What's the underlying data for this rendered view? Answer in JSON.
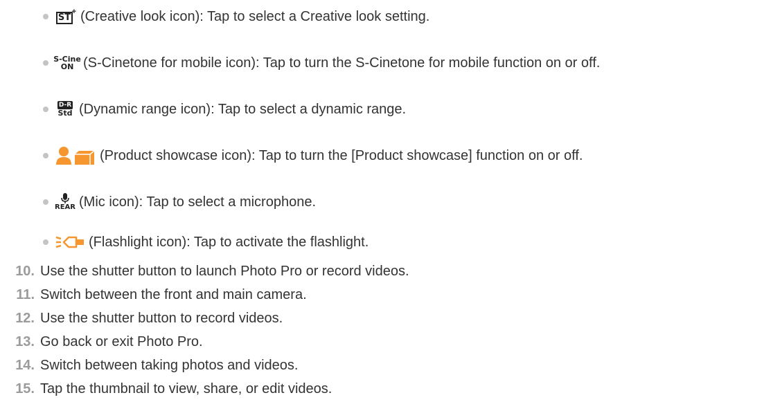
{
  "bullets": [
    {
      "icon": "creative-look-icon",
      "text": "(Creative look icon): Tap to select a Creative look setting."
    },
    {
      "icon": "s-cinetone-icon",
      "text": "(S-Cinetone for mobile icon): Tap to turn the S-Cinetone for mobile function on or off."
    },
    {
      "icon": "dynamic-range-icon",
      "text": "(Dynamic range icon): Tap to select a dynamic range."
    },
    {
      "icon": "product-showcase-icon",
      "text": "(Product showcase icon): Tap to turn the [Product showcase] function on or off."
    },
    {
      "icon": "mic-icon",
      "text": "(Mic icon): Tap to select a microphone."
    },
    {
      "icon": "flashlight-icon",
      "text": "(Flashlight icon): Tap to activate the flashlight."
    }
  ],
  "icon_text": {
    "st": "ST",
    "scine_top": "S-Cine",
    "scine_bottom": "ON",
    "dr_top": "D-R",
    "dr_bottom": "Std",
    "mic_bottom": "REAR"
  },
  "steps": [
    {
      "num": "10.",
      "text": "Use the shutter button to launch Photo Pro or record videos."
    },
    {
      "num": "11.",
      "text": "Switch between the front and main camera."
    },
    {
      "num": "12.",
      "text": "Use the shutter button to record videos."
    },
    {
      "num": "13.",
      "text": "Go back or exit Photo Pro."
    },
    {
      "num": "14.",
      "text": "Switch between taking photos and videos."
    },
    {
      "num": "15.",
      "text": "Tap the thumbnail to view, share, or edit videos."
    }
  ],
  "colors": {
    "icon_orange": "#f5962e",
    "bullet_dot": "#c4c4c4",
    "number_gray": "#9b9b9b"
  }
}
